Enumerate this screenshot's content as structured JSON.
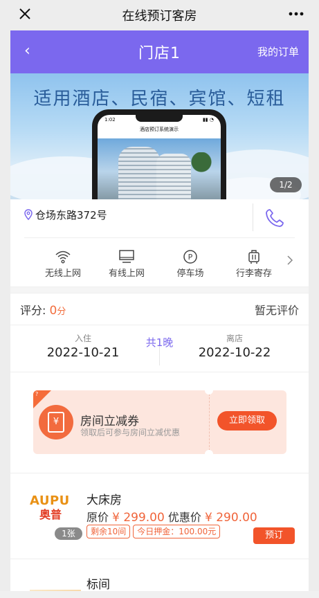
{
  "wechat": {
    "title": "在线预订客房",
    "close_icon": "close-icon",
    "more_icon": "more-icon"
  },
  "nav": {
    "back": "‹",
    "title": "门店1",
    "orders": "我的订单",
    "color": "#7b68ee"
  },
  "banner": {
    "text": "适用酒店、民宿、宾馆、短租",
    "phone_time": "1:02",
    "phone_title": "酒店预订系统演示",
    "counter": "1/2"
  },
  "address": {
    "text": "仓场东路372号",
    "icon": "location-pin-icon",
    "phone_icon": "phone-icon"
  },
  "facilities": [
    {
      "label": "无线上网",
      "icon": "wifi-icon"
    },
    {
      "label": "有线上网",
      "icon": "monitor-icon"
    },
    {
      "label": "停车场",
      "icon": "parking-icon"
    },
    {
      "label": "行李寄存",
      "icon": "luggage-icon"
    }
  ],
  "rating": {
    "label": "评分:",
    "value": "0",
    "unit": "分",
    "review": "暂无评价"
  },
  "dates": {
    "checkin_label": "入住",
    "checkin": "2022-10-21",
    "nights": "共1晚",
    "checkout_label": "离店",
    "checkout": "2022-10-22"
  },
  "coupon": {
    "corner": "?",
    "icon_glyph": "¥",
    "title": "房间立减券",
    "subtitle": "领取后可参与房间立减优惠",
    "button": "立即领取"
  },
  "rooms": [
    {
      "name": "大床房",
      "logo_top": "AUPU",
      "logo_bottom": "奥普",
      "count": "1张",
      "orig_label": "原价",
      "orig_price": "¥ 299.00",
      "sale_label": "优惠价",
      "sale_price": "¥ 290.00",
      "tag1": "剩余10间",
      "tag2": "今日押金：100.00元",
      "button": "预订"
    },
    {
      "name": "标间"
    }
  ]
}
